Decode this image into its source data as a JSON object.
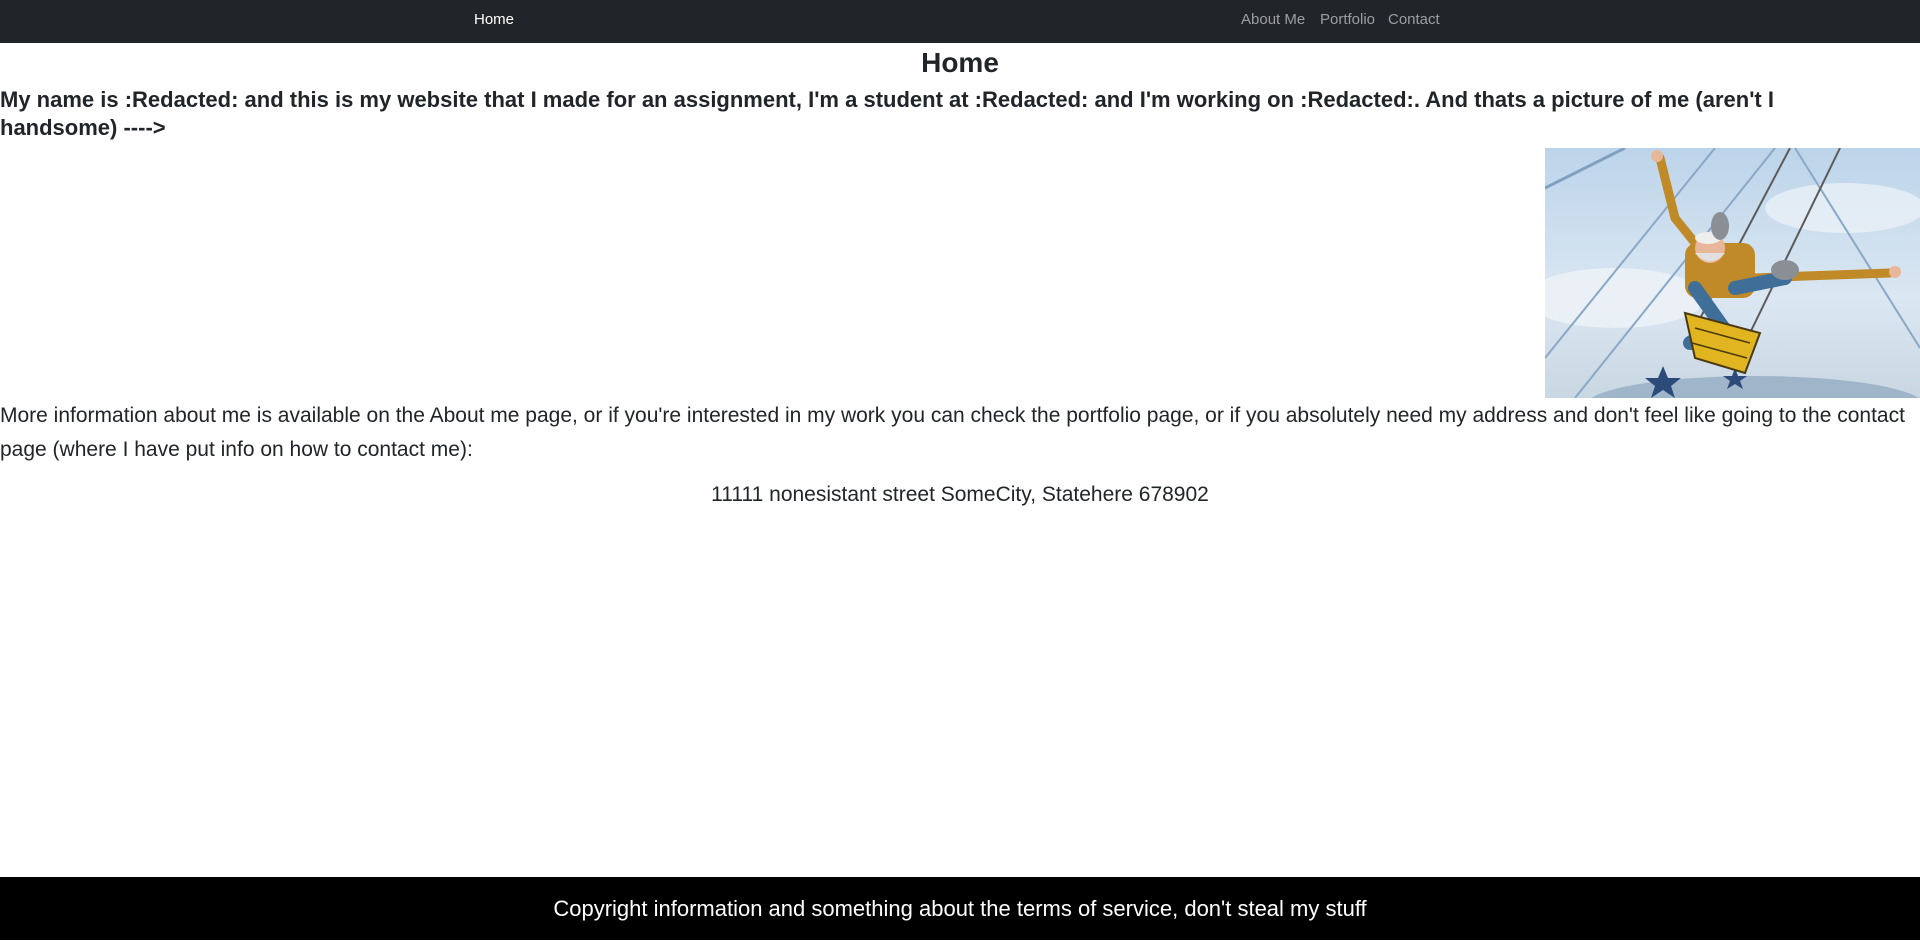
{
  "navbar": {
    "home_label": "Home",
    "about_label": "About Me",
    "portfolio_label": "Portfolio",
    "contact_label": "Contact"
  },
  "main": {
    "title": "Home",
    "intro": "My name is :Redacted: and this is my website that I made for an assignment, I'm a student at :Redacted: and I'm working on :Redacted:. And thats a picture of me (aren't I handsome) ---->",
    "more_info": "More information about me is available on the About me page, or if you're interested in my work you can check the portfolio page, or if you absolutely need my address and don't feel like going to the contact page (where I have put info on how to contact me):",
    "address": "11111 nonesistant street SomeCity, Statehere 678902"
  },
  "footer": {
    "text": "Copyright information and something about the terms of service, don't steal my stuff"
  },
  "colors": {
    "navbar_bg": "#212529",
    "footer_bg": "#000000",
    "text": "#212529"
  }
}
